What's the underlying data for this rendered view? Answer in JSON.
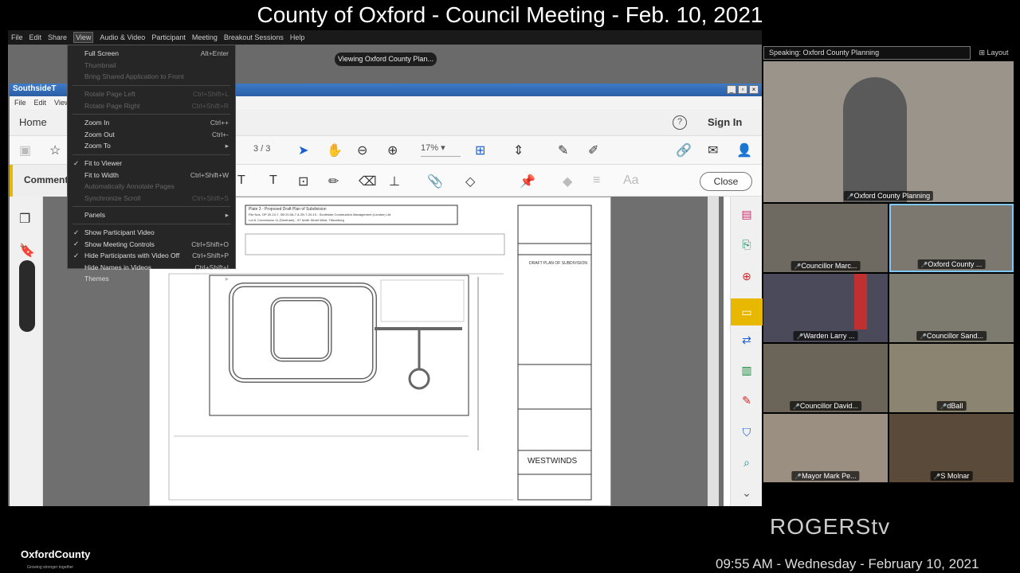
{
  "broadcast": {
    "title": "County of Oxford - Council Meeting - Feb. 10, 2021",
    "timestamp": "09:55 AM - Wednesday - February 10, 2021",
    "channel_logo": "ROGERS",
    "channel_logo_suffix": "tv",
    "org_logo": "OxfordCounty",
    "org_tagline": "Growing stronger together"
  },
  "zoom": {
    "menubar": [
      "File",
      "Edit",
      "Share",
      "View",
      "Audio & Video",
      "Participant",
      "Meeting",
      "Breakout Sessions",
      "Help"
    ],
    "active_menu": "View",
    "viewing_pill": "Viewing Oxford County Plan...",
    "speaking": "Speaking: Oxford County Planning",
    "layout_label": "Layout",
    "view_menu": [
      {
        "label": "Full Screen",
        "shortcut": "Alt+Enter",
        "disabled": false,
        "checked": false
      },
      {
        "label": "Thumbnail",
        "shortcut": "",
        "disabled": true,
        "checked": false
      },
      {
        "label": "Bring Shared Application to Front",
        "shortcut": "",
        "disabled": true,
        "checked": false
      },
      {
        "sep": true
      },
      {
        "label": "Rotate Page Left",
        "shortcut": "Ctrl+Shift+L",
        "disabled": true,
        "checked": false
      },
      {
        "label": "Rotate Page Right",
        "shortcut": "Ctrl+Shift+R",
        "disabled": true,
        "checked": false
      },
      {
        "sep": true
      },
      {
        "label": "Zoom In",
        "shortcut": "Ctrl++",
        "disabled": false,
        "checked": false
      },
      {
        "label": "Zoom Out",
        "shortcut": "Ctrl+-",
        "disabled": false,
        "checked": false
      },
      {
        "label": "Zoom To",
        "shortcut": "▸",
        "disabled": false,
        "checked": false
      },
      {
        "sep": true
      },
      {
        "label": "Fit to Viewer",
        "shortcut": "",
        "disabled": false,
        "checked": true
      },
      {
        "label": "Fit to Width",
        "shortcut": "Ctrl+Shift+W",
        "disabled": false,
        "checked": false
      },
      {
        "label": "Automatically Annotate Pages",
        "shortcut": "",
        "disabled": true,
        "checked": false
      },
      {
        "label": "Synchronize Scroll",
        "shortcut": "Ctrl+Shift+S",
        "disabled": true,
        "checked": false
      },
      {
        "sep": true
      },
      {
        "label": "Panels",
        "shortcut": "▸",
        "disabled": false,
        "checked": false
      },
      {
        "sep": true
      },
      {
        "label": "Show Participant Video",
        "shortcut": "",
        "disabled": false,
        "checked": true
      },
      {
        "label": "Show Meeting Controls",
        "shortcut": "Ctrl+Shift+O",
        "disabled": false,
        "checked": true
      },
      {
        "label": "Hide Participants with Video Off",
        "shortcut": "Ctrl+Shift+P",
        "disabled": false,
        "checked": true
      },
      {
        "label": "Hide Names in Videos",
        "shortcut": "Ctrl+Shift+I",
        "disabled": false,
        "checked": false
      },
      {
        "label": "Themes",
        "shortcut": "▸",
        "disabled": false,
        "checked": false
      }
    ],
    "participants": [
      {
        "name": "Oxford County Planning",
        "bg": "#8a8578"
      },
      {
        "name": "Councillor Marc...",
        "bg": "#6e6a62"
      },
      {
        "name": "Oxford County ...",
        "bg": "#7c786f"
      },
      {
        "name": "Warden Larry ...",
        "bg": "#4a4a5a"
      },
      {
        "name": "Councillor Sand...",
        "bg": "#7d7a70"
      },
      {
        "name": "Councillor David...",
        "bg": "#6a6558"
      },
      {
        "name": "dBall",
        "bg": "#8a8470"
      },
      {
        "name": "Mayor Mark Pe...",
        "bg": "#9a8f80"
      },
      {
        "name": "S Molnar",
        "bg": "#5a4a3a"
      }
    ]
  },
  "acrobat": {
    "window_title": "SouthsideT",
    "menubar": [
      "File",
      "Edit",
      "View"
    ],
    "home_tab": "Home",
    "help_icon": "?",
    "sign_in": "Sign In",
    "page_indicator": "3 / 3",
    "zoom_level": "17%",
    "comment_label": "Comment",
    "close_label": "Close",
    "doc": {
      "header_line1": "Plate 3 - Proposed Draft Plan of Subdivision",
      "header_line2": "File Nos. OP 20-10-7, SB 20-06-7 & ZN 7-20-10 - Southside Construction Management (London) Ltd",
      "header_line3": "Lot 8, Concession 11 (Dereham) - 57 North Street West, Tillsonburg",
      "title_block": "DRAFT PLAN OF SUBDIVISION",
      "project_name": "WESTWINDS"
    }
  }
}
